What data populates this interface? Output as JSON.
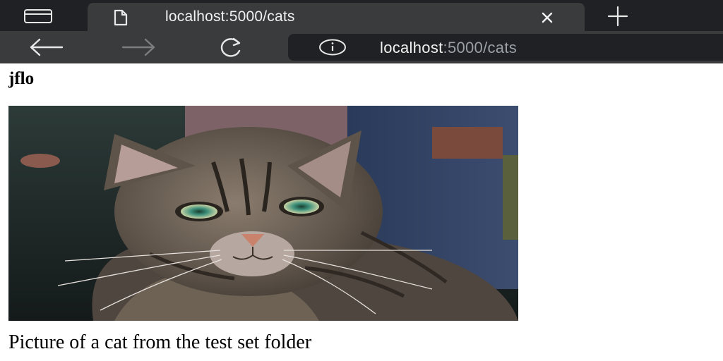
{
  "browser": {
    "tab": {
      "title": "localhost:5000/cats"
    },
    "address_bar": {
      "host": "localhost",
      "path": ":5000/cats"
    }
  },
  "page": {
    "username": "jflo",
    "image": {
      "subject": "tabby cat photo"
    },
    "caption": "Picture of a cat from the test set folder"
  },
  "icons": [
    "tab-actions-icon",
    "page-icon",
    "close-icon",
    "new-tab-icon",
    "back-icon",
    "forward-icon",
    "refresh-icon",
    "info-icon"
  ],
  "colors": {
    "tabstrip": "#202124",
    "toolbar": "#3a3b3c",
    "text_light": "#f1f1f1",
    "url_dim": "#9aa0a6"
  }
}
